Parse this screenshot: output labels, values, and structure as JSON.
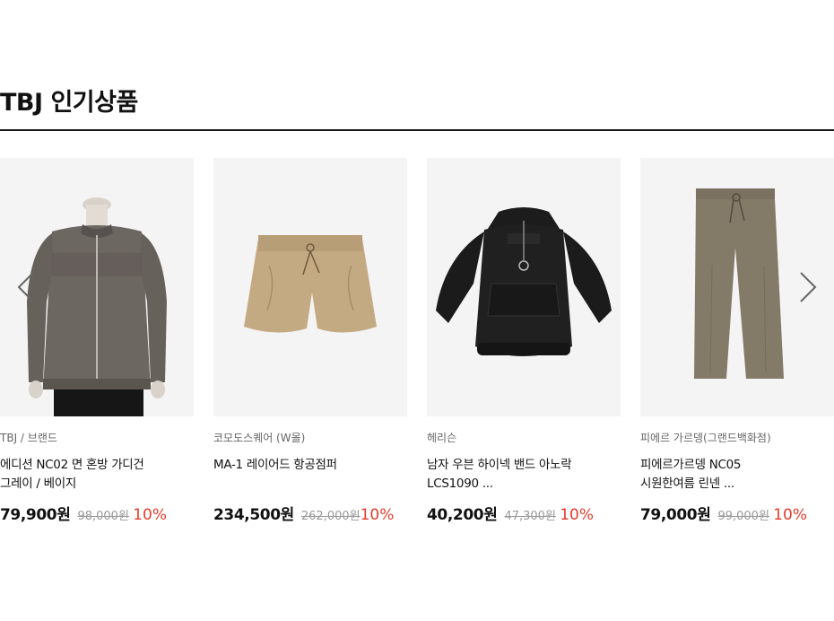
{
  "section": {
    "title": "TBJ 인기상품"
  },
  "colors": {
    "discount": "#e53b2c",
    "thumb_bg": "#f4f4f4"
  },
  "carousel": {
    "prev_icon": "chevron-left-icon",
    "next_icon": "chevron-right-icon",
    "products": [
      {
        "brand": "TBJ / 브랜드",
        "name_line1": "에디션 NC02 면 혼방 가디건",
        "name_line2": "그레이 / 베이지",
        "price": "79,900원",
        "original_price": "98,000원",
        "discount": "10%",
        "image": "gray-knit-zip-cardigan"
      },
      {
        "brand": "코모도스퀘어 (W몰)",
        "name_line1": "MA-1 레이어드 항공점퍼",
        "name_line2": "",
        "price": "234,500원",
        "original_price": "262,000원",
        "discount": "10%",
        "image": "beige-drawstring-shorts"
      },
      {
        "brand": "헤리슨",
        "name_line1": "남자 우븐 하이넥 밴드 아노락",
        "name_line2": "LCS1090 ...",
        "price": "40,200원",
        "original_price": "47,300원",
        "discount": "10%",
        "image": "black-anorak-jacket"
      },
      {
        "brand": "피에르 가르뎅(그랜드백화점)",
        "name_line1": "피에르가르뎅 NC05",
        "name_line2": "시원한여름 린넨 ...",
        "price": "79,000원",
        "original_price": "99,000원",
        "discount": "10%",
        "image": "olive-drawstring-pants"
      }
    ]
  }
}
